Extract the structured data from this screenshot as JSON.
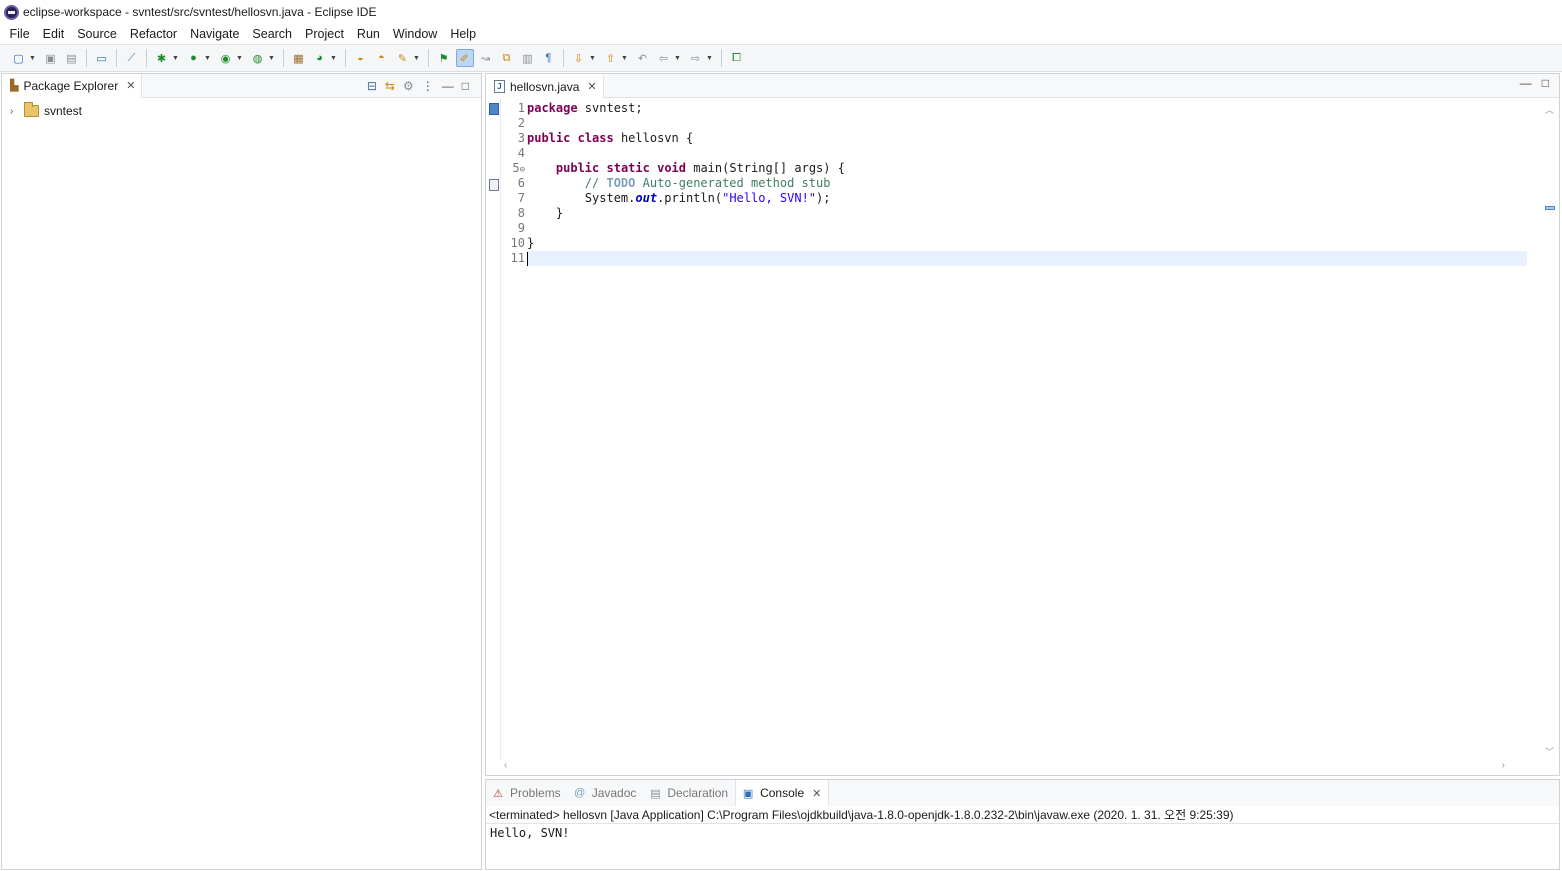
{
  "window": {
    "title": "eclipse-workspace - svntest/src/svntest/hellosvn.java - Eclipse IDE"
  },
  "menu": [
    "File",
    "Edit",
    "Source",
    "Refactor",
    "Navigate",
    "Search",
    "Project",
    "Run",
    "Window",
    "Help"
  ],
  "package_explorer": {
    "tab_label": "Package Explorer",
    "project": "svntest"
  },
  "editor": {
    "tab_label": "hellosvn.java",
    "line_numbers": [
      "1",
      "2",
      "3",
      "4",
      "5",
      "6",
      "7",
      "8",
      "9",
      "10",
      "11"
    ],
    "code_lines": [
      "package svntest;",
      "",
      "public class hellosvn {",
      "",
      "    public static void main(String[] args) {",
      "        // TODO Auto-generated method stub",
      "        System.out.println(\"Hello, SVN!\");",
      "    }",
      "",
      "}",
      ""
    ]
  },
  "bottom_panel": {
    "tabs": [
      "Problems",
      "Javadoc",
      "Declaration",
      "Console"
    ],
    "active_tab": "Console",
    "console_header": "<terminated> hellosvn [Java Application] C:\\Program Files\\ojdkbuild\\java-1.8.0-openjdk-1.8.0.232-2\\bin\\javaw.exe (2020. 1. 31. 오전 9:25:39)",
    "console_output": "Hello, SVN!"
  },
  "icons": {
    "accent": "#2f6db7"
  }
}
